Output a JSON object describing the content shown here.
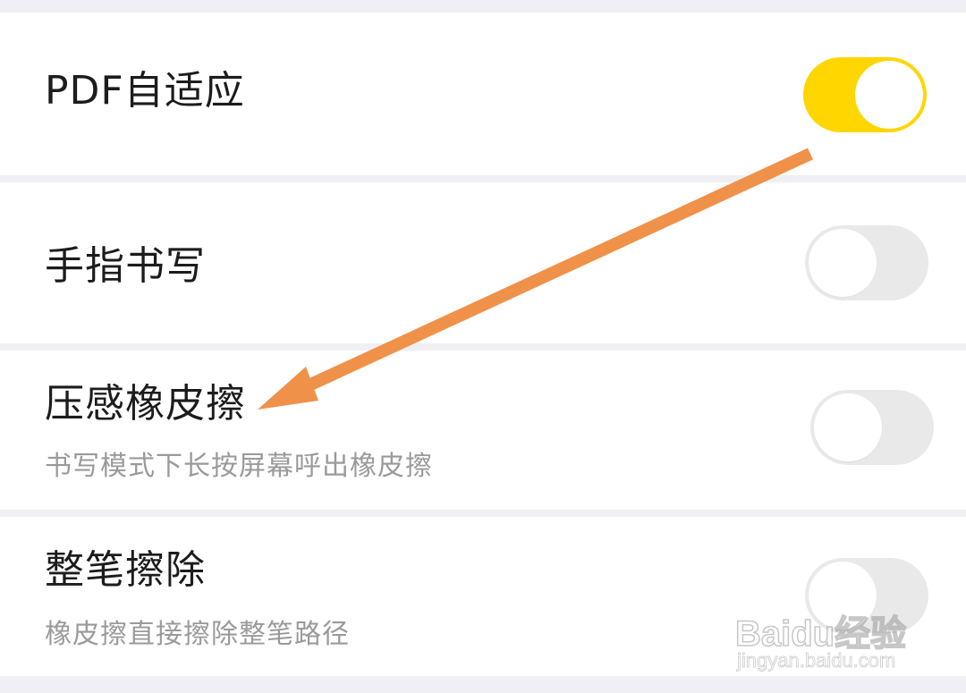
{
  "settings": [
    {
      "title": "PDF自适应",
      "subtitle": "",
      "toggle_on": true
    },
    {
      "title": "手指书写",
      "subtitle": "",
      "toggle_on": false
    },
    {
      "title": "压感橡皮擦",
      "subtitle": "书写模式下长按屏幕呼出橡皮擦",
      "toggle_on": false
    },
    {
      "title": "整笔擦除",
      "subtitle": "橡皮擦直接擦除整笔路径",
      "toggle_on": false
    }
  ],
  "colors": {
    "toggle_on": "#ffd600",
    "toggle_off": "#e9e9e9",
    "annotation_arrow": "#f0914a"
  },
  "watermark": {
    "logo": "Baidu经验",
    "url": "jingyan.baidu.com"
  }
}
